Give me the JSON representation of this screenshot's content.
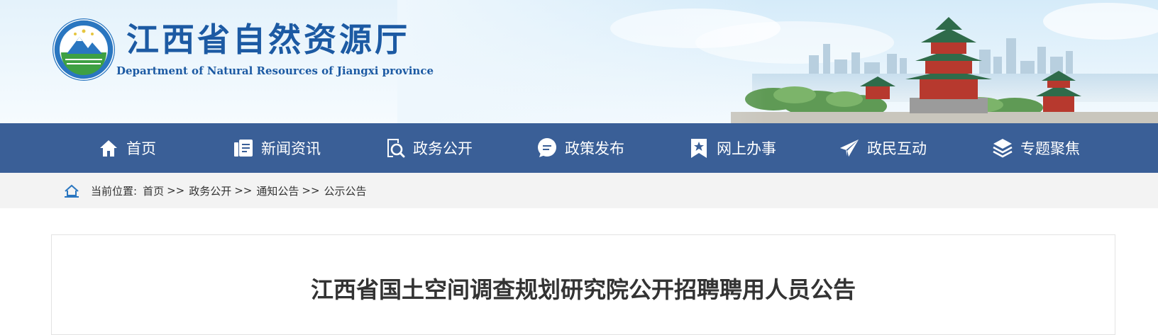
{
  "header": {
    "title": "江西省自然资源厅",
    "subtitle": "Department of Natural Resources of Jiangxi province"
  },
  "nav": {
    "items": [
      {
        "label": "首页",
        "icon": "home-icon"
      },
      {
        "label": "新闻资讯",
        "icon": "news-icon"
      },
      {
        "label": "政务公开",
        "icon": "document-search-icon"
      },
      {
        "label": "政策发布",
        "icon": "chat-bubble-icon"
      },
      {
        "label": "网上办事",
        "icon": "star-bookmark-icon"
      },
      {
        "label": "政民互动",
        "icon": "paper-plane-icon"
      },
      {
        "label": "专题聚焦",
        "icon": "layers-icon"
      }
    ]
  },
  "breadcrumb": {
    "prefix": "当前位置:",
    "items": [
      "首页",
      "政务公开",
      "通知公告",
      "公示公告"
    ],
    "separator": ">>"
  },
  "article": {
    "title": "江西省国土空间调查规划研究院公开招聘聘用人员公告"
  },
  "colors": {
    "brand_blue": "#1c5aa3",
    "nav_background": "#3a5f97",
    "breadcrumb_background": "#f3f3f3"
  }
}
